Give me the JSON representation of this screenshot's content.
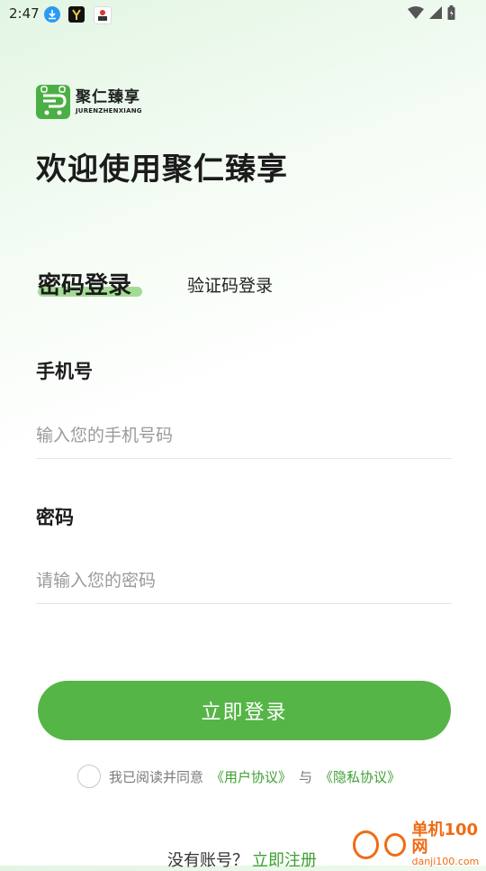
{
  "status_bar": {
    "time": "2:47"
  },
  "brand": {
    "name": "聚仁臻享",
    "latin": "JURENZHENXIANG"
  },
  "welcome_title": "欢迎使用聚仁臻享",
  "tabs": {
    "active": "密码登录",
    "inactive": "验证码登录"
  },
  "form": {
    "phone_label": "手机号",
    "phone_placeholder": "输入您的手机号码",
    "password_label": "密码",
    "password_placeholder": "请输入您的密码"
  },
  "login_button": "立即登录",
  "agreement": {
    "prefix": "我已阅读并同意",
    "user_agreement": "《用户协议》",
    "and": "与",
    "privacy": "《隐私协议》"
  },
  "register": {
    "question": "没有账号？",
    "link": "立即注册"
  },
  "watermark": {
    "main": "单机100网",
    "sub": "danji100.com"
  },
  "colors": {
    "accent": "#55b546",
    "link": "#3ea033",
    "tab_highlight": "#a3db95"
  }
}
